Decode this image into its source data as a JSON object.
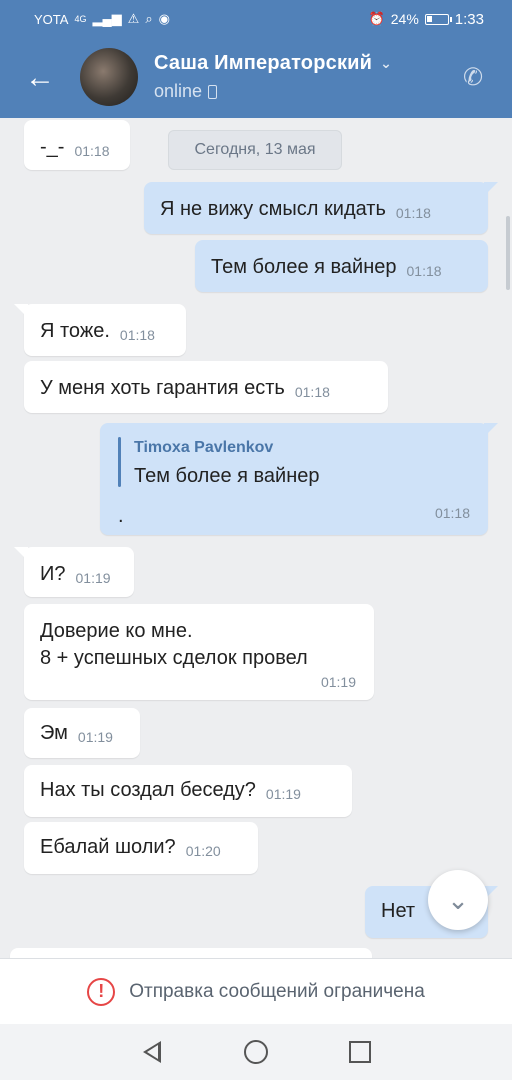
{
  "status_bar": {
    "carrier": "YOTA",
    "network": "4G",
    "battery": "24%",
    "time": "1:33",
    "battery_level": 0.24
  },
  "header": {
    "name": "Саша Императорский",
    "status": "online"
  },
  "date_chip": "Сегодня, 13 мая",
  "messages": [
    {
      "dir": "in",
      "text": "-_-",
      "time": "01:18"
    },
    {
      "dir": "out",
      "text": "Я не вижу смысл кидать",
      "time": "01:18"
    },
    {
      "dir": "out",
      "text": "Тем более я вайнер",
      "time": "01:18"
    },
    {
      "dir": "in",
      "text": "Я тоже.",
      "time": "01:18"
    },
    {
      "dir": "in",
      "text": "У меня хоть гарантия есть",
      "time": "01:18"
    },
    {
      "dir": "out",
      "reply_name": "Timoxa Pavlenkov",
      "reply_text": "Тем более я вайнер",
      "text": ".",
      "time": "01:18"
    },
    {
      "dir": "in",
      "text": "И?",
      "time": "01:19"
    },
    {
      "dir": "in",
      "text_line1": "Доверие ко мне.",
      "text_line2": "8 +  успешных сделок провел",
      "time": "01:19"
    },
    {
      "dir": "in",
      "text": "Эм",
      "time": "01:19"
    },
    {
      "dir": "in",
      "text": "Нах ты создал беседу?",
      "time": "01:19"
    },
    {
      "dir": "in",
      "text": "Ебалай шоли?",
      "time": "01:20"
    },
    {
      "dir": "out",
      "text": "Нет",
      "time": ""
    }
  ],
  "restriction": "Отправка сообщений ограничена",
  "icons": {
    "back": "arrow-left-icon",
    "call": "phone-icon",
    "scroll_down": "chevron-down-icon",
    "warning": "exclamation-circle-icon"
  },
  "colors": {
    "header": "#5181b8",
    "outgoing": "#cfe2f8",
    "incoming": "#ffffff",
    "background": "#edeef0",
    "warning": "#e64646"
  }
}
